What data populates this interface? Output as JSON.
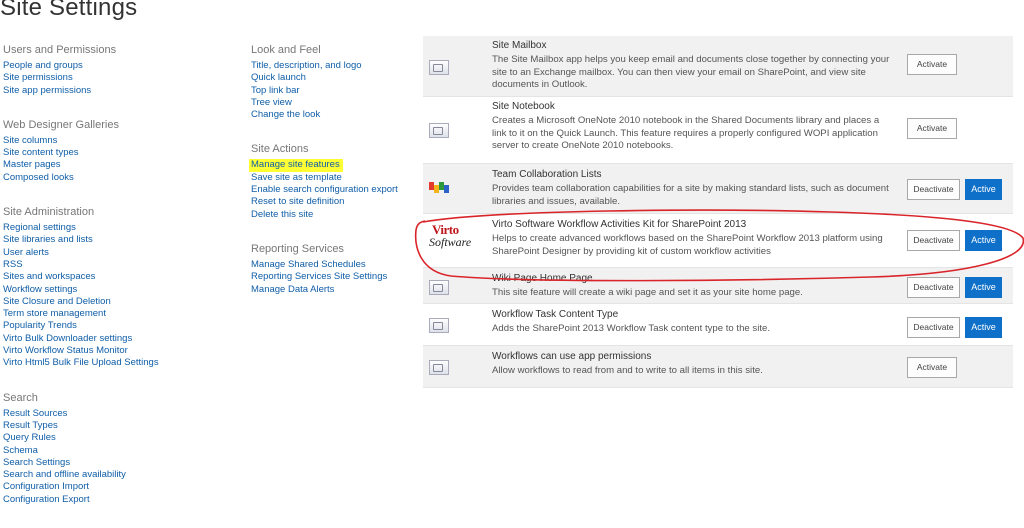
{
  "page": {
    "title": "Site Settings"
  },
  "left_column": [
    {
      "title": "Users and Permissions",
      "links": [
        "People and groups",
        "Site permissions",
        "Site app permissions"
      ]
    },
    {
      "title": "Web Designer Galleries",
      "links": [
        "Site columns",
        "Site content types",
        "Master pages",
        "Composed looks"
      ]
    },
    {
      "title": "Site Administration",
      "links": [
        "Regional settings",
        "Site libraries and lists",
        "User alerts",
        "RSS",
        "Sites and workspaces",
        "Workflow settings",
        "Site Closure and Deletion",
        "Term store management",
        "Popularity Trends",
        "Virto Bulk Downloader settings",
        "Virto Workflow Status Monitor",
        "Virto Html5 Bulk File Upload Settings"
      ]
    },
    {
      "title": "Search",
      "links": [
        "Result Sources",
        "Result Types",
        "Query Rules",
        "Schema",
        "Search Settings",
        "Search and offline availability",
        "Configuration Import",
        "Configuration Export"
      ]
    }
  ],
  "mid_column": [
    {
      "title": "Look and Feel",
      "links": [
        "Title, description, and logo",
        "Quick launch",
        "Top link bar",
        "Tree view",
        "Change the look"
      ]
    },
    {
      "title": "Site Actions",
      "links": [
        "Manage site features",
        "Save site as template",
        "Enable search configuration export",
        "Reset to site definition",
        "Delete this site"
      ]
    },
    {
      "title": "Reporting Services",
      "links": [
        "Manage Shared Schedules",
        "Reporting Services Site Settings",
        "Manage Data Alerts"
      ]
    }
  ],
  "features": [
    {
      "title": "Site Mailbox",
      "description": "The Site Mailbox app helps you keep email and documents close together by connecting your site to an Exchange mailbox. You can then view your email on SharePoint, and view site documents in Outlook.",
      "button": "Activate",
      "status": "",
      "icon": "feature-placeholder-icon"
    },
    {
      "title": "Site Notebook",
      "description": "Creates a Microsoft OneNote 2010 notebook in the Shared Documents library and places a link to it on the Quick Launch. This feature requires a properly configured WOPI application server to create OneNote 2010 notebooks.",
      "button": "Activate",
      "status": "",
      "icon": "feature-placeholder-icon"
    },
    {
      "title": "Team Collaboration Lists",
      "description": "Provides team collaboration capabilities for a site by making standard lists, such as document libraries and issues, available.",
      "button": "Deactivate",
      "status": "Active",
      "icon": "team-collaboration-icon"
    },
    {
      "title": "Virto Software Workflow Activities Kit for SharePoint 2013",
      "description": "Helps to create advanced workflows based on the SharePoint Workflow 2013 platform using SharePoint Designer by providing kit of custom workflow activities",
      "button": "Deactivate",
      "status": "Active",
      "icon": "virto-software-logo",
      "logo_top": "Virto",
      "logo_bottom": "Software"
    },
    {
      "title": "Wiki Page Home Page",
      "description": "This site feature will create a wiki page and set it as your site home page.",
      "button": "Deactivate",
      "status": "Active",
      "icon": "feature-placeholder-icon"
    },
    {
      "title": "Workflow Task Content Type",
      "description": "Adds the SharePoint 2013 Workflow Task content type to the site.",
      "button": "Deactivate",
      "status": "Active",
      "icon": "feature-placeholder-icon"
    },
    {
      "title": "Workflows can use app permissions",
      "description": "Allow workflows to read from and to write to all items in this site.",
      "button": "Activate",
      "status": "",
      "icon": "feature-placeholder-icon"
    }
  ],
  "colors": {
    "link": "#0f5ea8",
    "active_button": "#0e70c9",
    "highlight": "#ffff33",
    "annotation": "#d9252a"
  }
}
